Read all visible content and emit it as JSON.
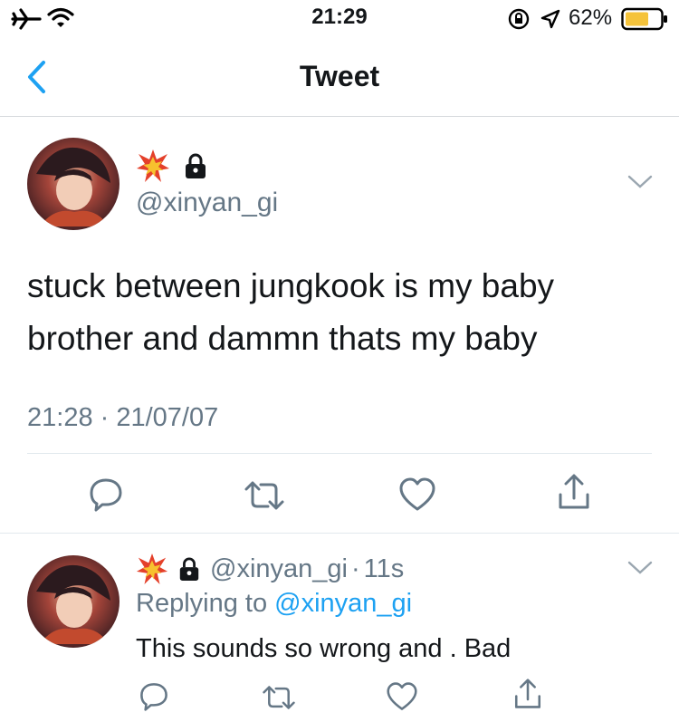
{
  "status_bar": {
    "time": "21:29",
    "battery_percent": "62%",
    "icons": [
      "airplane-icon",
      "wifi-icon",
      "orientation-lock-icon",
      "location-icon",
      "battery-icon"
    ]
  },
  "nav": {
    "title": "Tweet",
    "back_icon": "chevron-left-icon"
  },
  "main_tweet": {
    "handle": "@xinyan_gi",
    "display_name_icons": [
      "collision-emoji",
      "lock-icon"
    ],
    "text": "stuck between jungkook is my baby brother and dammn thats my baby",
    "timestamp": "21:28 · 21/07/07",
    "actions": [
      "reply-icon",
      "retweet-icon",
      "like-icon",
      "share-icon"
    ]
  },
  "reply_tweet": {
    "handle": "@xinyan_gi",
    "separator": "·",
    "age": "11s",
    "replying_to_label": "Replying to",
    "replying_to_handle": "@xinyan_gi",
    "text": "This sounds so wrong and . Bad",
    "actions": [
      "reply-icon",
      "retweet-icon",
      "like-icon",
      "share-icon"
    ]
  },
  "colors": {
    "accent": "#1da1f2",
    "text": "#14171a",
    "secondary": "#657786",
    "battery_fill": "#f5c33b"
  }
}
